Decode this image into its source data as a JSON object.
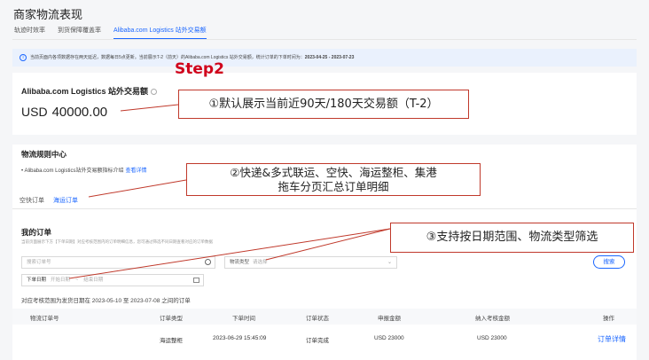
{
  "page": {
    "title": "商家物流表现"
  },
  "tabs": [
    {
      "label": "轨迹时效率"
    },
    {
      "label": "到货保障覆盖率"
    },
    {
      "label": "Alibaba.com Logistics 站外交易额"
    }
  ],
  "info_bar": {
    "text": "当前页面内各项数据存在两天延迟，数据每日5点更新。当前展示T-2（前天）的Alibaba.com Logistics 站外交易额，统计订单的下单时间为：",
    "range": "2023-04-25 - 2023-07-23"
  },
  "annotations": {
    "step_label": "Step2",
    "callout1": "①默认展示当前近90天/180天交易额（T-2）",
    "callout2_line1": "②快递&多式联运、空快、海运整柜、集港",
    "callout2_line2": "拖车分页汇总订单明细",
    "callout3": "③支持按日期范围、物流类型筛选"
  },
  "gmv": {
    "title": "Alibaba.com Logistics 站外交易额",
    "currency": "USD",
    "amount": "40000.00"
  },
  "rules": {
    "title": "物流规则中心",
    "bullet": "Alibaba.com Logistics站外交易额指标介绍",
    "link": "查看详情"
  },
  "subtabs": [
    {
      "label": "空快订单"
    },
    {
      "label": "海运订单"
    }
  ],
  "orders": {
    "title": "我的订单",
    "hint": "当前页面展示下方【下单日期】对应考核范围内的订单明细信息，您可通过筛选不同日期查看对应的订单数据",
    "search_placeholder": "搜索订单号",
    "type_label": "物流类型",
    "type_placeholder": "请选择",
    "date_label": "下单日期",
    "date_start": "开始日期",
    "date_sep": "~",
    "date_end": "结束日期",
    "reset": "重置",
    "search": "搜索",
    "range_text": "对应考核范围为发货日期在 2023-05-10 至 2023-07-08 之间的订单"
  },
  "table": {
    "headers": [
      "物流订单号",
      "订单类型",
      "下单时间",
      "订单状态",
      "申报金额",
      "纳入考核金额",
      "操作"
    ],
    "rows": [
      {
        "order_no": "",
        "type": "海运整柜",
        "time": "2023-06-29 15:45:09",
        "status": "订单完成",
        "declared": "USD 23000",
        "counted": "USD 23000",
        "action": "订单详情"
      }
    ]
  },
  "colors": {
    "accent": "#1a66ff",
    "annotation": "#c0392b"
  }
}
